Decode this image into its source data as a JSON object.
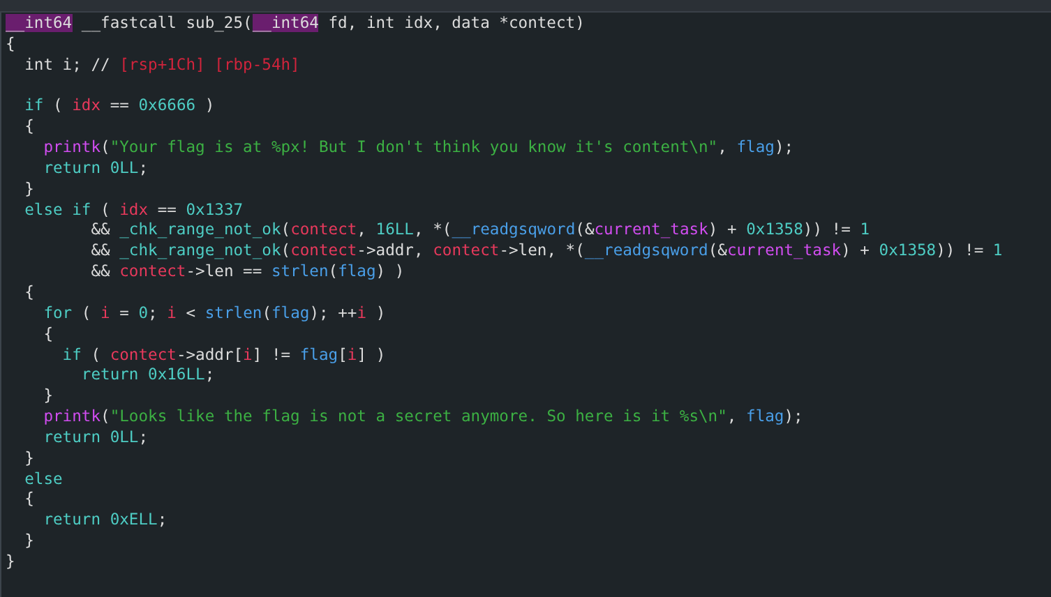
{
  "code_lines": [
    {
      "tokens": [
        {
          "kind": "typehl",
          "text": "__int64"
        },
        {
          "kind": "plain",
          "text": " __fastcall sub_25("
        },
        {
          "kind": "typehl",
          "text": "__int64"
        },
        {
          "kind": "plain",
          "text": " fd, int idx, data *contect)"
        }
      ]
    },
    {
      "tokens": [
        {
          "kind": "plain",
          "text": "{"
        }
      ]
    },
    {
      "tokens": [
        {
          "kind": "plain",
          "text": "  int i; // "
        },
        {
          "kind": "stackref",
          "text": "[rsp+1Ch] [rbp-54h]"
        }
      ]
    },
    {
      "blank_line_before": true,
      "tokens": [
        {
          "kind": "keyword",
          "text": "  if"
        },
        {
          "kind": "plain",
          "text": " ( "
        },
        {
          "kind": "local",
          "text": "idx"
        },
        {
          "kind": "plain",
          "text": " == "
        },
        {
          "kind": "number",
          "text": "0x6666"
        },
        {
          "kind": "plain",
          "text": " )"
        }
      ]
    },
    {
      "tokens": [
        {
          "kind": "plain",
          "text": "  {"
        }
      ]
    },
    {
      "tokens": [
        {
          "kind": "extern",
          "text": "    printk"
        },
        {
          "kind": "plain",
          "text": "("
        },
        {
          "kind": "string",
          "text": "\"Your flag is at %px! But I don't think you know it's content\\n\""
        },
        {
          "kind": "plain",
          "text": ", "
        },
        {
          "kind": "global",
          "text": "flag"
        },
        {
          "kind": "plain",
          "text": ");"
        }
      ]
    },
    {
      "tokens": [
        {
          "kind": "keyword",
          "text": "    return"
        },
        {
          "kind": "number",
          "text": " 0LL"
        },
        {
          "kind": "plain",
          "text": ";"
        }
      ]
    },
    {
      "tokens": [
        {
          "kind": "plain",
          "text": "  }"
        }
      ]
    },
    {
      "tokens": [
        {
          "kind": "keyword",
          "text": "  else if"
        },
        {
          "kind": "plain",
          "text": " ( "
        },
        {
          "kind": "local",
          "text": "idx"
        },
        {
          "kind": "plain",
          "text": " == "
        },
        {
          "kind": "number",
          "text": "0x1337"
        }
      ]
    },
    {
      "tokens": [
        {
          "kind": "plain",
          "text": "         && "
        },
        {
          "kind": "func",
          "text": "_chk_range_not_ok"
        },
        {
          "kind": "plain",
          "text": "("
        },
        {
          "kind": "local",
          "text": "contect"
        },
        {
          "kind": "plain",
          "text": ", "
        },
        {
          "kind": "number",
          "text": "16LL"
        },
        {
          "kind": "plain",
          "text": ", *("
        },
        {
          "kind": "import",
          "text": "__readgsqword"
        },
        {
          "kind": "plain",
          "text": "(&"
        },
        {
          "kind": "extern",
          "text": "current_task"
        },
        {
          "kind": "plain",
          "text": ") + "
        },
        {
          "kind": "number",
          "text": "0x1358"
        },
        {
          "kind": "plain",
          "text": ")) != "
        },
        {
          "kind": "number",
          "text": "1"
        }
      ]
    },
    {
      "tokens": [
        {
          "kind": "plain",
          "text": "         && "
        },
        {
          "kind": "func",
          "text": "_chk_range_not_ok"
        },
        {
          "kind": "plain",
          "text": "("
        },
        {
          "kind": "local",
          "text": "contect"
        },
        {
          "kind": "plain",
          "text": "->addr, "
        },
        {
          "kind": "local",
          "text": "contect"
        },
        {
          "kind": "plain",
          "text": "->len, *("
        },
        {
          "kind": "import",
          "text": "__readgsqword"
        },
        {
          "kind": "plain",
          "text": "(&"
        },
        {
          "kind": "extern",
          "text": "current_task"
        },
        {
          "kind": "plain",
          "text": ") + "
        },
        {
          "kind": "number",
          "text": "0x1358"
        },
        {
          "kind": "plain",
          "text": ")) != "
        },
        {
          "kind": "number",
          "text": "1"
        }
      ]
    },
    {
      "tokens": [
        {
          "kind": "plain",
          "text": "         && "
        },
        {
          "kind": "local",
          "text": "contect"
        },
        {
          "kind": "plain",
          "text": "->len == "
        },
        {
          "kind": "import",
          "text": "strlen"
        },
        {
          "kind": "plain",
          "text": "("
        },
        {
          "kind": "global",
          "text": "flag"
        },
        {
          "kind": "plain",
          "text": ") )"
        }
      ]
    },
    {
      "tokens": [
        {
          "kind": "plain",
          "text": "  {"
        }
      ]
    },
    {
      "tokens": [
        {
          "kind": "keyword",
          "text": "    for"
        },
        {
          "kind": "plain",
          "text": " ( "
        },
        {
          "kind": "local",
          "text": "i"
        },
        {
          "kind": "plain",
          "text": " = "
        },
        {
          "kind": "number",
          "text": "0"
        },
        {
          "kind": "plain",
          "text": "; "
        },
        {
          "kind": "local",
          "text": "i"
        },
        {
          "kind": "plain",
          "text": " < "
        },
        {
          "kind": "import",
          "text": "strlen"
        },
        {
          "kind": "plain",
          "text": "("
        },
        {
          "kind": "global",
          "text": "flag"
        },
        {
          "kind": "plain",
          "text": "); ++"
        },
        {
          "kind": "local",
          "text": "i"
        },
        {
          "kind": "plain",
          "text": " )"
        }
      ]
    },
    {
      "tokens": [
        {
          "kind": "plain",
          "text": "    {"
        }
      ]
    },
    {
      "tokens": [
        {
          "kind": "keyword",
          "text": "      if"
        },
        {
          "kind": "plain",
          "text": " ( "
        },
        {
          "kind": "local",
          "text": "contect"
        },
        {
          "kind": "plain",
          "text": "->addr["
        },
        {
          "kind": "local",
          "text": "i"
        },
        {
          "kind": "plain",
          "text": "] != "
        },
        {
          "kind": "global",
          "text": "flag"
        },
        {
          "kind": "plain",
          "text": "["
        },
        {
          "kind": "local",
          "text": "i"
        },
        {
          "kind": "plain",
          "text": "] )"
        }
      ]
    },
    {
      "tokens": [
        {
          "kind": "keyword",
          "text": "        return"
        },
        {
          "kind": "number",
          "text": " 0x16LL"
        },
        {
          "kind": "plain",
          "text": ";"
        }
      ]
    },
    {
      "tokens": [
        {
          "kind": "plain",
          "text": "    }"
        }
      ]
    },
    {
      "tokens": [
        {
          "kind": "extern",
          "text": "    printk"
        },
        {
          "kind": "plain",
          "text": "("
        },
        {
          "kind": "string",
          "text": "\"Looks like the flag is not a secret anymore. So here is it %s\\n\""
        },
        {
          "kind": "plain",
          "text": ", "
        },
        {
          "kind": "global",
          "text": "flag"
        },
        {
          "kind": "plain",
          "text": ");"
        }
      ]
    },
    {
      "tokens": [
        {
          "kind": "keyword",
          "text": "    return"
        },
        {
          "kind": "number",
          "text": " 0LL"
        },
        {
          "kind": "plain",
          "text": ";"
        }
      ]
    },
    {
      "tokens": [
        {
          "kind": "plain",
          "text": "  }"
        }
      ]
    },
    {
      "tokens": [
        {
          "kind": "keyword",
          "text": "  else"
        }
      ]
    },
    {
      "tokens": [
        {
          "kind": "plain",
          "text": "  {"
        }
      ]
    },
    {
      "tokens": [
        {
          "kind": "keyword",
          "text": "    return"
        },
        {
          "kind": "number",
          "text": " 0xELL"
        },
        {
          "kind": "plain",
          "text": ";"
        }
      ]
    },
    {
      "tokens": [
        {
          "kind": "plain",
          "text": "  }"
        }
      ]
    },
    {
      "tokens": [
        {
          "kind": "plain",
          "text": "}"
        }
      ]
    }
  ]
}
